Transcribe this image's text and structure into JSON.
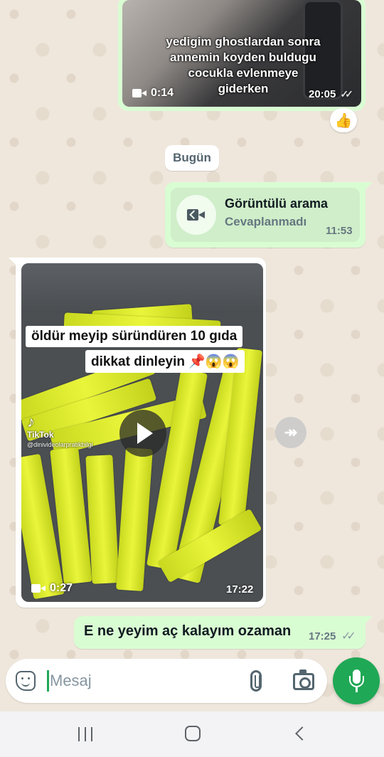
{
  "messages": {
    "top_video": {
      "caption": "yedigim ghostlardan sonra annemin koyden buldugu cocukla evlenmeye giderken",
      "duration": "0:14",
      "time": "20:05",
      "reaction": "👍"
    },
    "date_chip": "Bugün",
    "call": {
      "title": "Görüntülü arama",
      "status": "Cevaplanmadı",
      "time": "11:53"
    },
    "incoming_video": {
      "overlay_line1": "öldür meyip süründüren 10 gıda",
      "overlay_line2": "dikkat dinleyin 📌😱😱",
      "tiktok_logo": "♪",
      "tiktok_name": "TikTok",
      "tiktok_handle": "@dinivideolarpratikbilgi",
      "duration": "0:27",
      "time": "17:22"
    },
    "last_text": {
      "text": "E ne yeyim aç kalayım ozaman",
      "time": "17:25",
      "ticks": "✓✓"
    }
  },
  "composer": {
    "placeholder": "Mesaj"
  },
  "icons": {
    "forward": "forward-icon",
    "emoji": "sticker-icon",
    "attach": "paperclip-icon",
    "camera": "camera-icon",
    "mic": "mic-icon"
  },
  "colors": {
    "outgoing_bubble": "#d9fdd3",
    "incoming_bubble": "#ffffff",
    "accent_green": "#1fa855",
    "wallpaper": "#efe7dc"
  }
}
